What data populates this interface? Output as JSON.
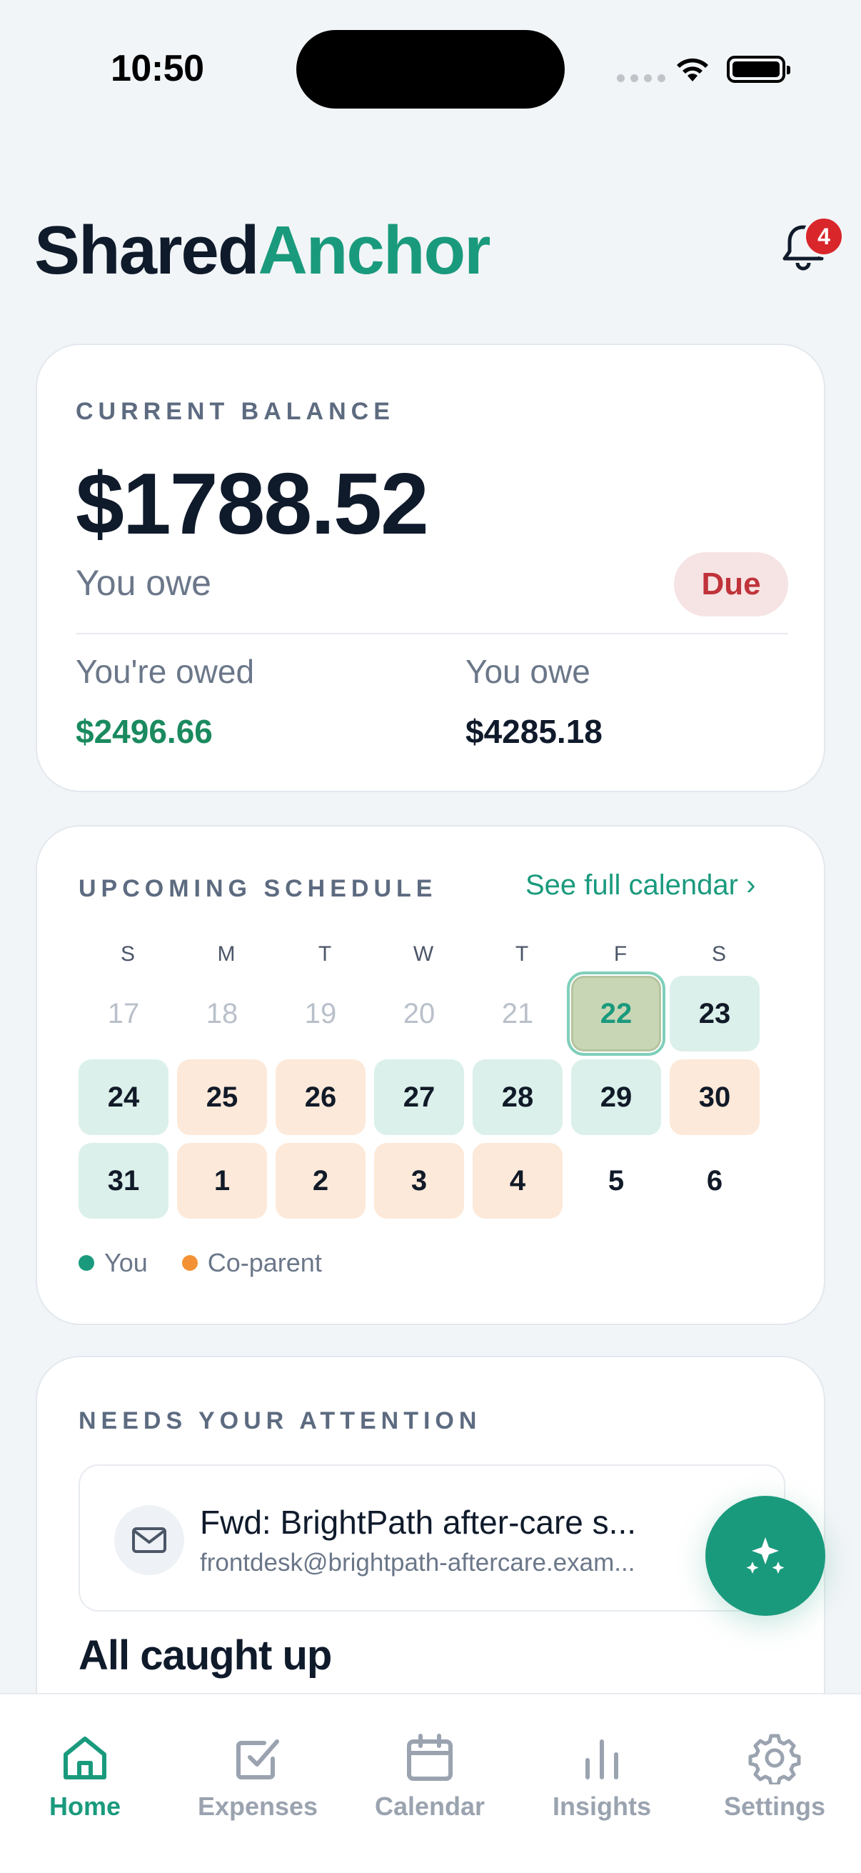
{
  "status_bar": {
    "time": "10:50"
  },
  "header": {
    "brand_part1": "Shared",
    "brand_part2": "Anchor",
    "notification_count": "4"
  },
  "balance": {
    "eyebrow": "CURRENT BALANCE",
    "amount": "$1788.52",
    "status_text": "You owe",
    "status_badge": "Due",
    "owed_to_you_label": "You're owed",
    "owed_to_you_value": "$2496.66",
    "you_owe_label": "You owe",
    "you_owe_value": "$4285.18"
  },
  "schedule": {
    "eyebrow": "UPCOMING SCHEDULE",
    "link": "See full calendar ›",
    "weekdays": [
      "S",
      "M",
      "T",
      "W",
      "T",
      "F",
      "S"
    ],
    "days": [
      {
        "label": "17",
        "state": "past"
      },
      {
        "label": "18",
        "state": "past"
      },
      {
        "label": "19",
        "state": "past"
      },
      {
        "label": "20",
        "state": "past"
      },
      {
        "label": "21",
        "state": "past"
      },
      {
        "label": "22",
        "state": "today"
      },
      {
        "label": "23",
        "state": "you"
      },
      {
        "label": "24",
        "state": "you"
      },
      {
        "label": "25",
        "state": "coparent"
      },
      {
        "label": "26",
        "state": "coparent"
      },
      {
        "label": "27",
        "state": "you"
      },
      {
        "label": "28",
        "state": "you"
      },
      {
        "label": "29",
        "state": "you"
      },
      {
        "label": "30",
        "state": "coparent"
      },
      {
        "label": "31",
        "state": "you"
      },
      {
        "label": "1",
        "state": "coparent"
      },
      {
        "label": "2",
        "state": "coparent"
      },
      {
        "label": "3",
        "state": "coparent"
      },
      {
        "label": "4",
        "state": "coparent"
      },
      {
        "label": "5",
        "state": "none"
      },
      {
        "label": "6",
        "state": "none"
      }
    ],
    "legend_you": "You",
    "legend_coparent": "Co-parent",
    "colors": {
      "you": "#1a9a7d",
      "coparent": "#f39234"
    }
  },
  "attention": {
    "eyebrow": "NEEDS YOUR ATTENTION",
    "item_title": "Fwd: BrightPath after-care s...",
    "item_sender": "frontdesk@brightpath-aftercare.exam...",
    "empty_state": "All caught up"
  },
  "tabs": [
    {
      "label": "Home",
      "icon": "home-icon",
      "active": true
    },
    {
      "label": "Expenses",
      "icon": "checkbox-icon",
      "active": false
    },
    {
      "label": "Calendar",
      "icon": "calendar-icon",
      "active": false
    },
    {
      "label": "Insights",
      "icon": "bar-chart-icon",
      "active": false
    },
    {
      "label": "Settings",
      "icon": "gear-icon",
      "active": false
    }
  ],
  "theme": {
    "accent": "#1a9a7d",
    "danger": "#c0333a"
  }
}
